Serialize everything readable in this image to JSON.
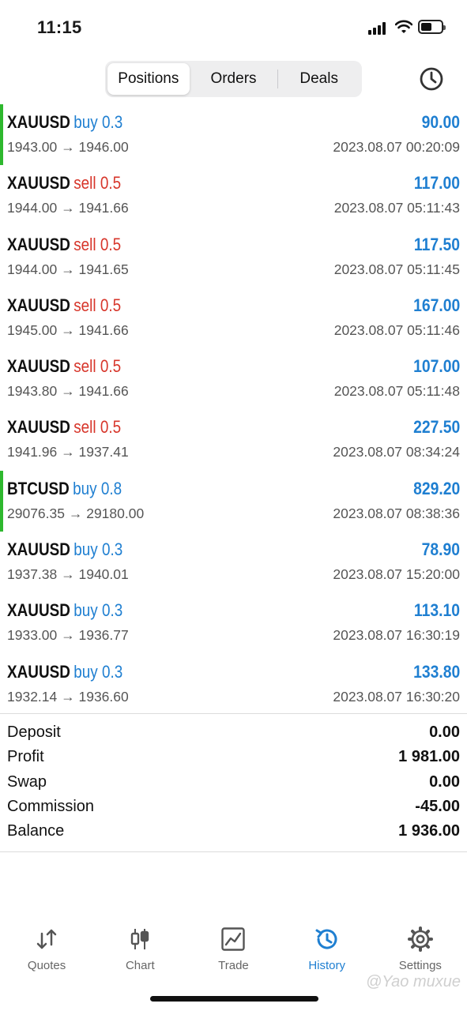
{
  "status": {
    "time": "11:15"
  },
  "tabs": {
    "positions": "Positions",
    "orders": "Orders",
    "deals": "Deals"
  },
  "trades": [
    {
      "symbol": "XAUUSD",
      "side": "buy",
      "side_label": "buy 0.3",
      "prices": "1943.00 → 1946.00",
      "profit": "90.00",
      "time": "2023.08.07 00:20:09",
      "marker": true
    },
    {
      "symbol": "XAUUSD",
      "side": "sell",
      "side_label": "sell 0.5",
      "prices": "1944.00 → 1941.66",
      "profit": "117.00",
      "time": "2023.08.07 05:11:43",
      "marker": false
    },
    {
      "symbol": "XAUUSD",
      "side": "sell",
      "side_label": "sell 0.5",
      "prices": "1944.00 → 1941.65",
      "profit": "117.50",
      "time": "2023.08.07 05:11:45",
      "marker": false
    },
    {
      "symbol": "XAUUSD",
      "side": "sell",
      "side_label": "sell 0.5",
      "prices": "1945.00 → 1941.66",
      "profit": "167.00",
      "time": "2023.08.07 05:11:46",
      "marker": false
    },
    {
      "symbol": "XAUUSD",
      "side": "sell",
      "side_label": "sell 0.5",
      "prices": "1943.80 → 1941.66",
      "profit": "107.00",
      "time": "2023.08.07 05:11:48",
      "marker": false
    },
    {
      "symbol": "XAUUSD",
      "side": "sell",
      "side_label": "sell 0.5",
      "prices": "1941.96 → 1937.41",
      "profit": "227.50",
      "time": "2023.08.07 08:34:24",
      "marker": false
    },
    {
      "symbol": "BTCUSD",
      "side": "buy",
      "side_label": "buy 0.8",
      "prices": "29076.35 → 29180.00",
      "profit": "829.20",
      "time": "2023.08.07 08:38:36",
      "marker": true
    },
    {
      "symbol": "XAUUSD",
      "side": "buy",
      "side_label": "buy 0.3",
      "prices": "1937.38 → 1940.01",
      "profit": "78.90",
      "time": "2023.08.07 15:20:00",
      "marker": false
    },
    {
      "symbol": "XAUUSD",
      "side": "buy",
      "side_label": "buy 0.3",
      "prices": "1933.00 → 1936.77",
      "profit": "113.10",
      "time": "2023.08.07 16:30:19",
      "marker": false
    },
    {
      "symbol": "XAUUSD",
      "side": "buy",
      "side_label": "buy 0.3",
      "prices": "1932.14 → 1936.60",
      "profit": "133.80",
      "time": "2023.08.07 16:30:20",
      "marker": false
    }
  ],
  "summary": [
    {
      "label": "Deposit",
      "value": "0.00"
    },
    {
      "label": "Profit",
      "value": "1 981.00"
    },
    {
      "label": "Swap",
      "value": "0.00"
    },
    {
      "label": "Commission",
      "value": "-45.00"
    },
    {
      "label": "Balance",
      "value": "1 936.00"
    }
  ],
  "tabbar": [
    {
      "label": "Quotes",
      "icon": "quotes-icon",
      "active": false
    },
    {
      "label": "Chart",
      "icon": "chart-icon",
      "active": false
    },
    {
      "label": "Trade",
      "icon": "trade-icon",
      "active": false
    },
    {
      "label": "History",
      "icon": "history-icon",
      "active": true
    },
    {
      "label": "Settings",
      "icon": "settings-icon",
      "active": false
    }
  ],
  "colors": {
    "buy": "#1f7fd1",
    "sell": "#d7352a",
    "accent": "#1f7fd1",
    "marker": "#2eb82e"
  },
  "watermark": "@Yao muxue"
}
